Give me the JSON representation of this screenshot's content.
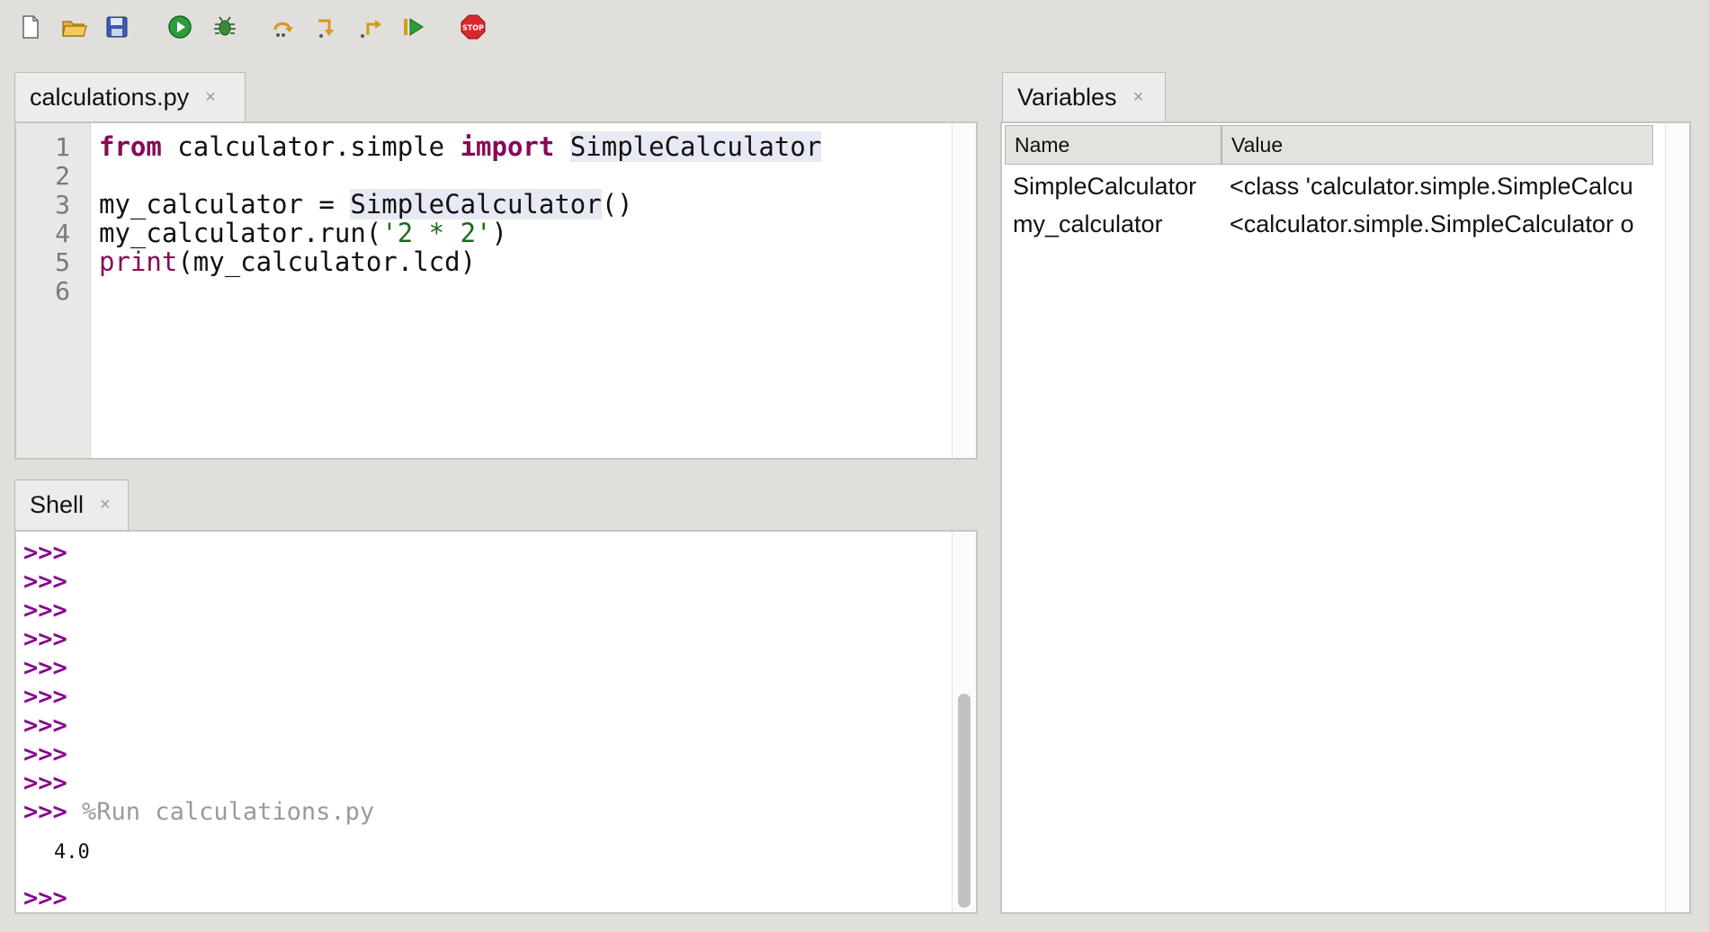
{
  "toolbar": {
    "icons": [
      "new-file-icon",
      "open-folder-icon",
      "save-icon",
      "run-icon",
      "debug-icon",
      "step-over-icon",
      "step-into-icon",
      "step-out-icon",
      "resume-icon",
      "stop-icon"
    ],
    "stop_label": "STOP"
  },
  "editor": {
    "tab_title": "calculations.py",
    "close_glyph": "×",
    "lines": [
      {
        "n": "1"
      },
      {
        "n": "2"
      },
      {
        "n": "3"
      },
      {
        "n": "4"
      },
      {
        "n": "5"
      },
      {
        "n": "6"
      }
    ],
    "code": {
      "l1_from": "from",
      "l1_module": " calculator.simple ",
      "l1_import": "import",
      "l1_name": "SimpleCalculator",
      "l3_var": "my_calculator = ",
      "l3_call": "SimpleCalculator",
      "l3_parens": "()",
      "l4_pre": "my_calculator.run(",
      "l4_str": "'2 * 2'",
      "l4_post": ")",
      "l5_fn": "print",
      "l5_rest": "(my_calculator.lcd)"
    }
  },
  "shell": {
    "tab_title": "Shell",
    "close_glyph": "×",
    "prompt": ">>>",
    "command": " %Run calculations.py",
    "output": "4.0"
  },
  "variables": {
    "tab_title": "Variables",
    "close_glyph": "×",
    "columns": [
      "Name",
      "Value"
    ],
    "rows": [
      {
        "name": "SimpleCalculator",
        "value": "<class 'calculator.simple.SimpleCalcu"
      },
      {
        "name": "my_calculator",
        "value": "<calculator.simple.SimpleCalculator o"
      }
    ]
  },
  "colors": {
    "keyword": "#870a58",
    "prompt": "#870a8e",
    "string": "#1a6b1a",
    "background": "#e1dfdc"
  }
}
